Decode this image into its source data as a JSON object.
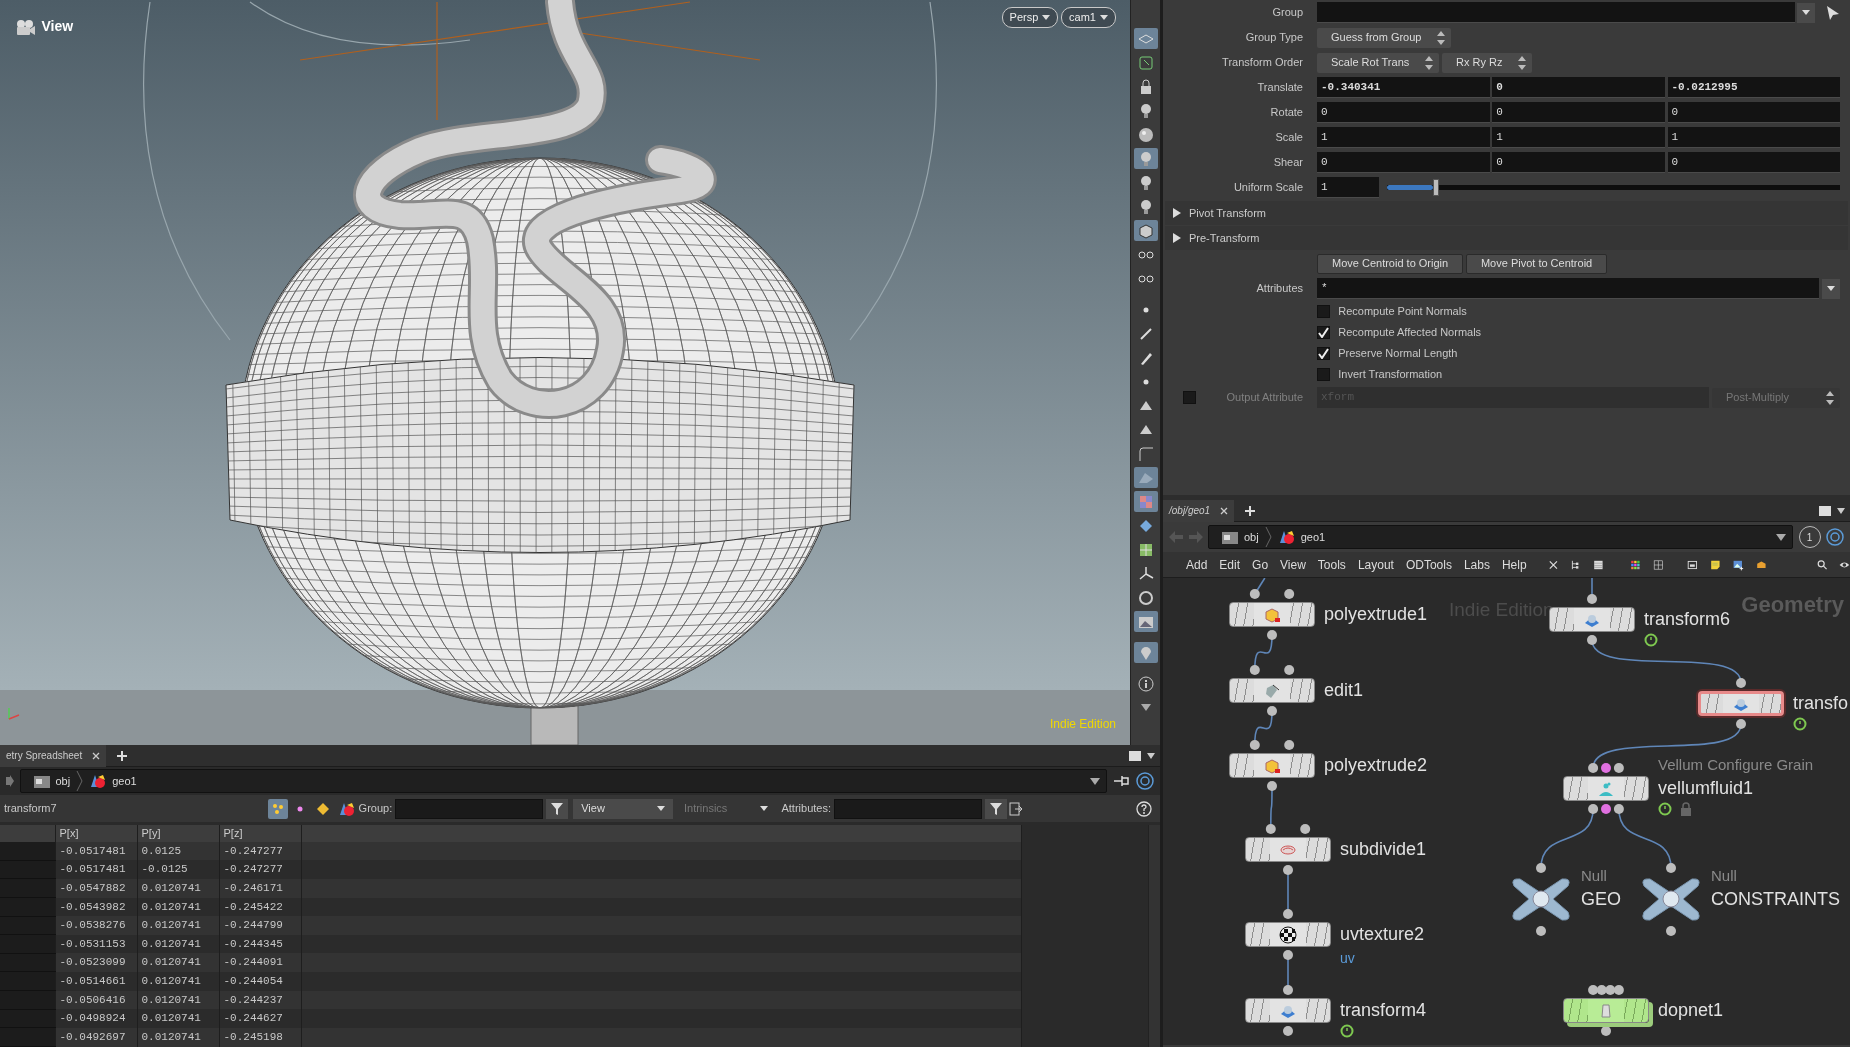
{
  "viewport": {
    "title": "View",
    "projection": "Persp",
    "camera": "cam1",
    "watermark": "Indie Edition",
    "tools": [
      {
        "on": true
      },
      {
        "on": false
      },
      {
        "on": false
      },
      {
        "on": false
      },
      {
        "on": false
      },
      {
        "on": true
      },
      {
        "on": false
      },
      {
        "on": false
      },
      {
        "on": true
      },
      {
        "on": false
      },
      {
        "on": false
      },
      {
        "on": false
      },
      {
        "on": false
      },
      {
        "on": false
      },
      {
        "on": false
      },
      {
        "on": false
      },
      {
        "on": false
      },
      {
        "on": false
      },
      {
        "on": true
      },
      {
        "on": true
      },
      {
        "on": false
      },
      {
        "on": false
      },
      {
        "on": false
      },
      {
        "on": false
      },
      {
        "on": true
      },
      {
        "on": true
      },
      {
        "on": false
      },
      {
        "on": false
      }
    ]
  },
  "spreadsheet": {
    "tab": "etry Spreadsheet",
    "path": [
      "obj",
      "geo1"
    ],
    "node": "transform7",
    "class_buttons": [
      {
        "selected": true
      },
      {
        "selected": false
      },
      {
        "selected": false
      },
      {
        "selected": false
      }
    ],
    "group_label": "Group:",
    "view_menu": "View",
    "intrinsics_menu": "Intrinsics",
    "attributes_label": "Attributes:",
    "columns": [
      "P[x]",
      "P[y]",
      "P[z]"
    ],
    "rows": [
      [
        "-0.0517481",
        "0.0125",
        "-0.247277"
      ],
      [
        "-0.0517481",
        "-0.0125",
        "-0.247277"
      ],
      [
        "-0.0547882",
        "0.0120741",
        "-0.246171"
      ],
      [
        "-0.0543982",
        "0.0120741",
        "-0.245422"
      ],
      [
        "-0.0538276",
        "0.0120741",
        "-0.244799"
      ],
      [
        "-0.0531153",
        "0.0120741",
        "-0.244345"
      ],
      [
        "-0.0523099",
        "0.0120741",
        "-0.244091"
      ],
      [
        "-0.0514661",
        "0.0120741",
        "-0.244054"
      ],
      [
        "-0.0506416",
        "0.0120741",
        "-0.244237"
      ],
      [
        "-0.0498924",
        "0.0120741",
        "-0.244627"
      ],
      [
        "-0.0492697",
        "0.0120741",
        "-0.245198"
      ]
    ]
  },
  "parameters": [
    {
      "kind": "field",
      "label": "Group",
      "dropdown": true,
      "selector": true
    },
    {
      "kind": "menus",
      "label": "Group Type",
      "menus": [
        "Guess from Group"
      ]
    },
    {
      "kind": "menus",
      "label": "Transform Order",
      "menus": [
        "Scale Rot Trans",
        "Rx Ry Rz"
      ]
    },
    {
      "kind": "vector",
      "label": "Translate",
      "values": [
        "-0.340341",
        "0",
        "-0.0212995"
      ],
      "modified": true
    },
    {
      "kind": "vector",
      "label": "Rotate",
      "values": [
        "0",
        "0",
        "0"
      ],
      "modified": false
    },
    {
      "kind": "vector",
      "label": "Scale",
      "values": [
        "1",
        "1",
        "1"
      ],
      "modified": false
    },
    {
      "kind": "vector",
      "label": "Shear",
      "values": [
        "0",
        "0",
        "0"
      ],
      "modified": false
    },
    {
      "kind": "slider",
      "label": "Uniform Scale",
      "value": "1",
      "level": 0.1
    },
    {
      "kind": "folder",
      "label": "Pivot Transform",
      "expanded": false
    },
    {
      "kind": "folder",
      "label": "Pre-Transform",
      "expanded": false
    },
    {
      "kind": "buttons",
      "buttons": [
        "Move Centroid to Origin",
        "Move Pivot to Centroid"
      ]
    },
    {
      "kind": "field",
      "label": "Attributes",
      "value": "*",
      "dropdown": true,
      "selector": false
    },
    {
      "kind": "checkbox",
      "label": "Recompute Point Normals",
      "checked": false
    },
    {
      "kind": "checkbox",
      "label": "Recompute Affected Normals",
      "checked": true
    },
    {
      "kind": "checkbox",
      "label": "Preserve Normal Length",
      "checked": true
    },
    {
      "kind": "checkbox",
      "label": "Invert Transformation",
      "checked": false
    },
    {
      "kind": "toggle_field",
      "label": "Output Attribute",
      "checked": false,
      "value": "xform",
      "menu": "Post-Multiply",
      "disabled": true
    }
  ],
  "network": {
    "tab": "/obj/geo1",
    "path": [
      "obj",
      "geo1"
    ],
    "counter": "1",
    "menus": [
      "Add",
      "Edit",
      "Go",
      "View",
      "Tools",
      "Layout",
      "ODTools",
      "Labs",
      "Help"
    ],
    "watermark": "Indie Edition",
    "context": "Geometry",
    "nodes": [
      {
        "name": "polyextrude1",
        "kind": "polyextrude",
        "selected": false,
        "time_dependent": false,
        "locked": false
      },
      {
        "name": "edit1",
        "kind": "edit",
        "selected": false,
        "time_dependent": false,
        "locked": false
      },
      {
        "name": "polyextrude2",
        "kind": "polyextrude",
        "selected": false,
        "time_dependent": false,
        "locked": false
      },
      {
        "name": "subdivide1",
        "kind": "subdivide",
        "selected": false,
        "time_dependent": false,
        "locked": false
      },
      {
        "name": "uvtexture2",
        "kind": "uvtexture",
        "selected": false,
        "time_dependent": false,
        "locked": false,
        "comment": "uv"
      },
      {
        "name": "transform4",
        "kind": "transform",
        "selected": false,
        "time_dependent": true,
        "locked": false
      },
      {
        "name": "transform6",
        "kind": "transform",
        "selected": false,
        "time_dependent": true,
        "locked": false
      },
      {
        "name": "transfo",
        "kind": "transform",
        "selected": true,
        "time_dependent": true,
        "locked": false
      },
      {
        "name": "vellumfluid1",
        "kind": "vellum",
        "type": "Vellum Configure Grain",
        "selected": false,
        "time_dependent": true,
        "locked": true
      },
      {
        "name": "GEO",
        "kind": "null",
        "type": "Null",
        "selected": false,
        "time_dependent": false,
        "locked": false
      },
      {
        "name": "CONSTRAINTS",
        "kind": "null",
        "type": "Null",
        "selected": false,
        "time_dependent": false,
        "locked": false
      },
      {
        "name": "dopnet1",
        "kind": "dopnet",
        "selected": false,
        "time_dependent": false,
        "locked": false
      }
    ]
  }
}
